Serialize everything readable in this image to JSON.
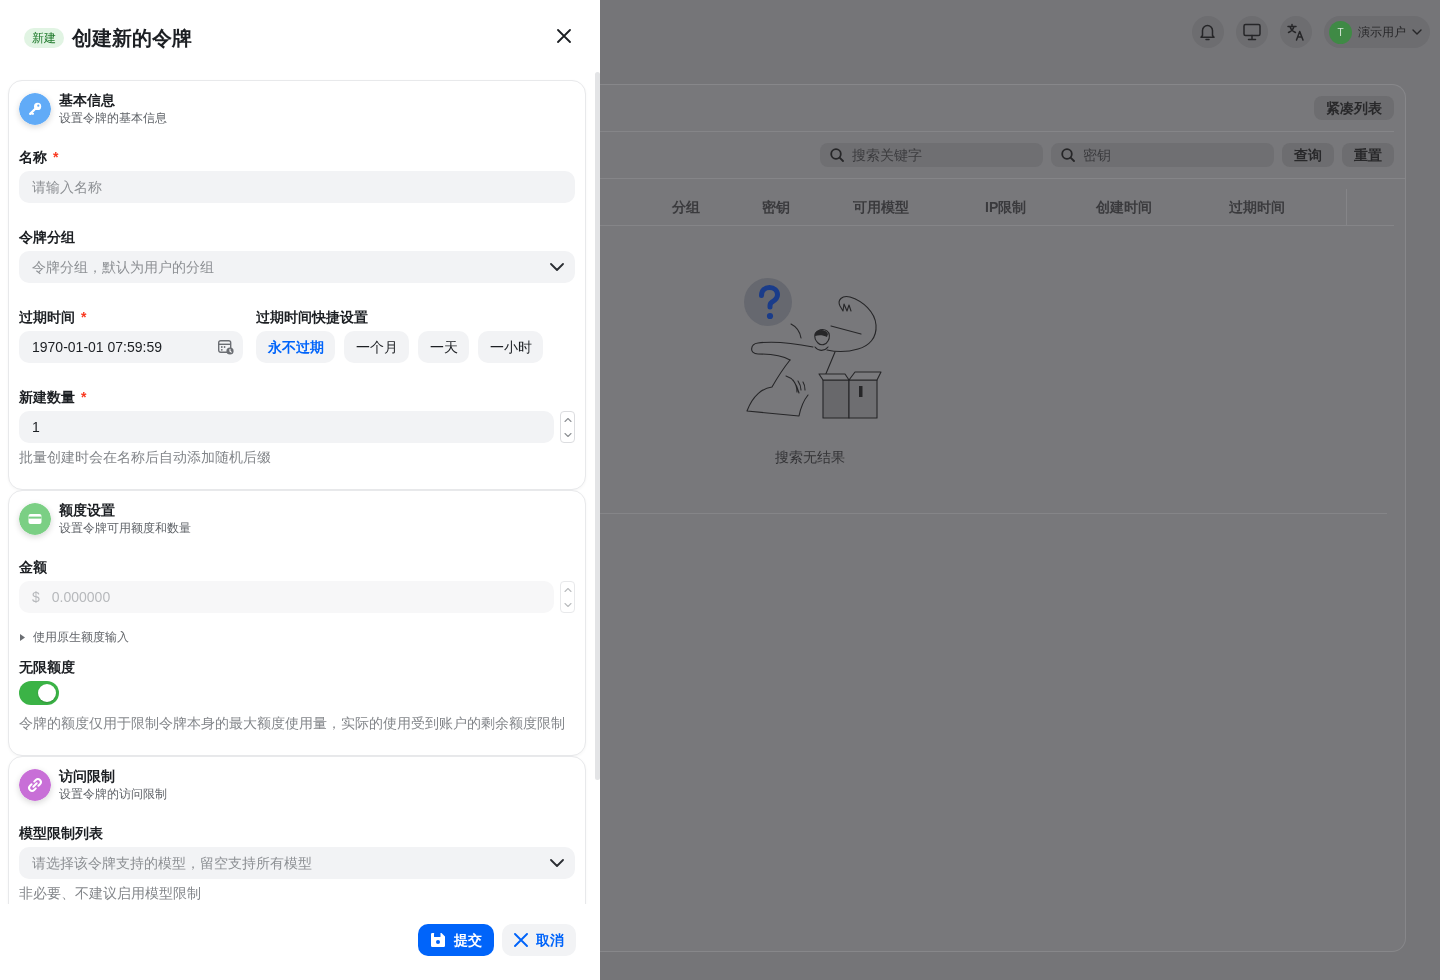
{
  "drawer": {
    "badge": "新建",
    "title": "创建新的令牌",
    "sections": [
      {
        "title": "基本信息",
        "subtitle": "设置令牌的基本信息",
        "color": "#61abf7",
        "fields": [
          {
            "kind": "text",
            "label": "名称",
            "required_mark": "*",
            "placeholder": "请输入名称"
          },
          {
            "kind": "select",
            "label": "令牌分组",
            "placeholder": "令牌分组，默认为用户的分组"
          },
          {
            "kind": "expiry",
            "label": "过期时间",
            "required_mark": "*",
            "value": "1970-01-01 07:59:59",
            "quick_label": "过期时间快捷设置",
            "quick_options": [
              {
                "label": "永不过期",
                "selected": true
              },
              {
                "label": "一个月",
                "selected": false
              },
              {
                "label": "一天",
                "selected": false
              },
              {
                "label": "一小时",
                "selected": false
              }
            ]
          },
          {
            "kind": "number",
            "label": "新建数量",
            "required_mark": "*",
            "value": "1",
            "hint": "批量创建时会在名称后自动添加随机后缀"
          }
        ]
      },
      {
        "title": "额度设置",
        "subtitle": "设置令牌可用额度和数量",
        "color": "#7bcf84",
        "fields": [
          {
            "kind": "amount",
            "label": "金额",
            "prefix": "$",
            "placeholder": "0.000000",
            "disabled": true
          },
          {
            "kind": "collapse",
            "label": "使用原生额度输入",
            "expanded": false
          },
          {
            "kind": "switch",
            "label": "无限额度",
            "on": true,
            "hint": "令牌的额度仅用于限制令牌本身的最大额度使用量，实际的使用受到账户的剩余额度限制"
          }
        ]
      },
      {
        "title": "访问限制",
        "subtitle": "设置令牌的访问限制",
        "color": "#c86fd7",
        "fields": [
          {
            "kind": "select",
            "label": "模型限制列表",
            "placeholder": "请选择该令牌支持的模型，留空支持所有模型",
            "hint": "非必要、不建议启用模型限制"
          }
        ]
      }
    ],
    "buttons": [
      {
        "kind": "primary",
        "label": "提交"
      },
      {
        "kind": "secondary",
        "label": "取消"
      }
    ]
  },
  "page": {
    "user": {
      "avatar": "T",
      "name": "演示用户"
    },
    "view_button": "紧凑列表",
    "search_fields": [
      {
        "placeholder": "搜索关键字"
      },
      {
        "placeholder": "密钥"
      }
    ],
    "search_buttons": [
      "查询",
      "重置"
    ],
    "table": {
      "columns": [
        "分组",
        "密钥",
        "可用模型",
        "IP限制",
        "创建时间",
        "过期时间"
      ]
    },
    "empty_text": "搜索无结果"
  }
}
